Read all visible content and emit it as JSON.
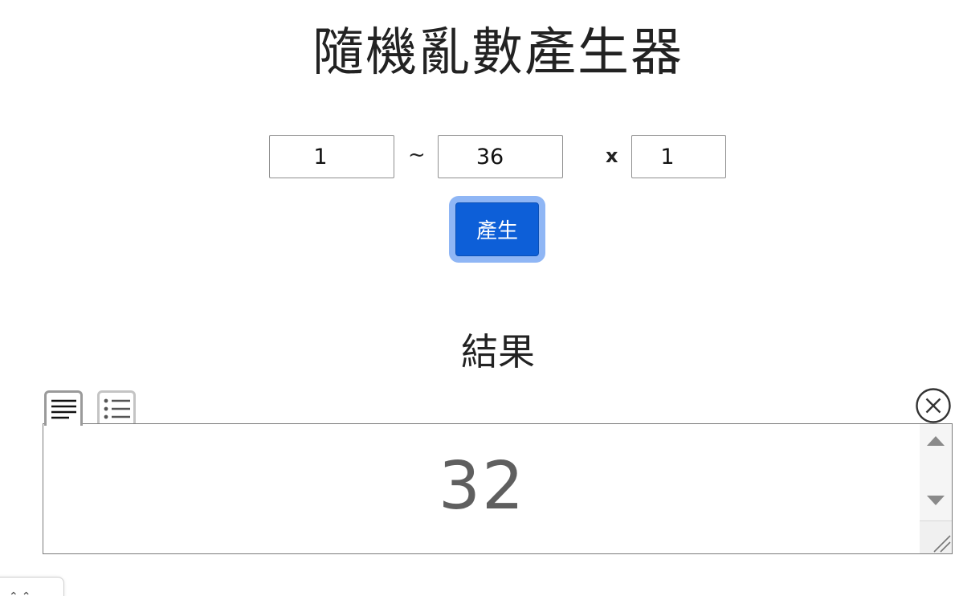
{
  "page": {
    "title": "隨機亂數產生器"
  },
  "range": {
    "min_value": "1",
    "separator": "~",
    "max_value": "36",
    "times_symbol": "x",
    "count_value": "1"
  },
  "actions": {
    "generate_label": "產生"
  },
  "result": {
    "heading": "結果",
    "value": "32",
    "view_modes": [
      "text-view-icon",
      "list-view-icon"
    ]
  },
  "colors": {
    "primary_button": "#0d5fd8",
    "focus_ring": "#8fb6f5",
    "result_text": "#5f5f5f"
  }
}
